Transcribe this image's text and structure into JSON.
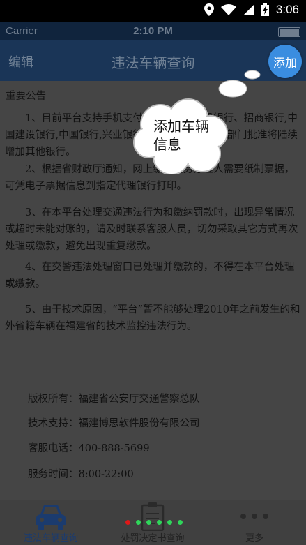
{
  "android_status": {
    "time": "3:06"
  },
  "ios_status": {
    "carrier": "Carrier",
    "time": "2:10 PM"
  },
  "navbar": {
    "edit_label": "编辑",
    "title": "违法车辆查询",
    "add_label": "添加"
  },
  "notice": {
    "title": "重要公告",
    "paragraphs": [
      "1、目前平台支持手机支付的银行有：建设银行、招商银行,中国建设银行,中国银行,兴业银行,交通银行。待有关部门批准将陆续增加其他银行。",
      "2、根据省财政厅通知，网上缴费业务办理人需要纸制票据，可凭电子票据信息到指定代理银行打印。",
      "3、在本平台处理交通违法行为和缴纳罚款时，出现异常情况或超时未能对账的，请及时联系客服人员，切勿采取其它方式再次处理或缴款，避免出现重复缴款。",
      "4、在交警违法处理窗口已处理并缴款的，不得在本平台处理或缴款。",
      "5、由于技术原因，“平台”暂不能够处理2010年之前发生的和外省籍车辆在福建省的技术监控违法行为。"
    ]
  },
  "footer": [
    "版权所有：福建省公安厅交通警察总队",
    "技术支持：福建博思软件股份有限公司",
    "客服电话：400-888-5699",
    "服务时间：8:00-22:00"
  ],
  "tooltip": {
    "line1": "添加车辆",
    "line2": "信息"
  },
  "tabs": [
    {
      "label": "违法车辆查询",
      "icon": "car-icon"
    },
    {
      "label": "处罚决定书查询",
      "icon": "clipboard-icon"
    },
    {
      "label": "更多",
      "icon": "more-icon"
    }
  ],
  "colors": {
    "accent": "#3a8de0",
    "navbar": "#1a3557",
    "overlay": "#454545"
  }
}
